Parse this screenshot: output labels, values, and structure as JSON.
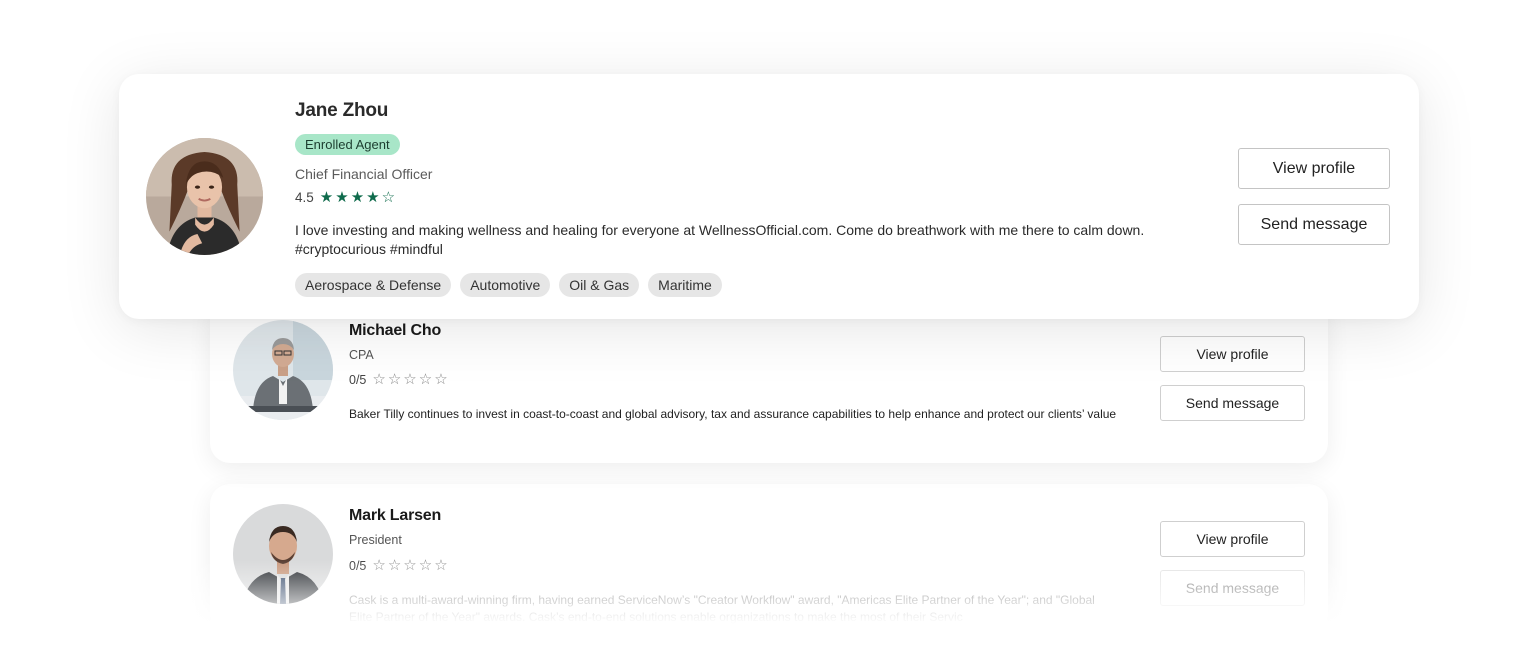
{
  "profiles": [
    {
      "name": "Jane Zhou",
      "badge": "Enrolled Agent",
      "title": "Chief Financial Officer",
      "rating": "4.5",
      "rating_value": 4.5,
      "bio": "I love investing and making wellness and healing for everyone at WellnessOfficial.com. Come do breathwork with me there to calm down. #cryptocurious #mindful",
      "tags": [
        "Aerospace & Defense",
        "Automotive",
        "Oil & Gas",
        "Maritime"
      ],
      "view_label": "View profile",
      "message_label": "Send message"
    },
    {
      "name": "Michael Cho",
      "title": "CPA",
      "rating": "0/5",
      "rating_value": 0,
      "bio": "Baker Tilly continues to invest in coast-to-coast and global advisory, tax and assurance capabilities to help enhance and protect our clients’ value",
      "view_label": "View profile",
      "message_label": "Send message"
    },
    {
      "name": "Mark Larsen",
      "title": "President",
      "rating": "0/5",
      "rating_value": 0,
      "bio": "Cask is a multi-award-winning firm, having earned ServiceNow’s \"Creator Workflow\" award, \"Americas Elite Partner of the Year\"; and \"Global Elite Partner of the Year\" awards. Cask’s end-to-end solutions enable organizations to make the most of their Servic",
      "view_label": "View profile",
      "message_label": "Send message"
    }
  ],
  "colors": {
    "badge_bg": "#a8e6c8",
    "star_filled": "#0f6b4c",
    "tag_bg": "#e6e6e6"
  }
}
